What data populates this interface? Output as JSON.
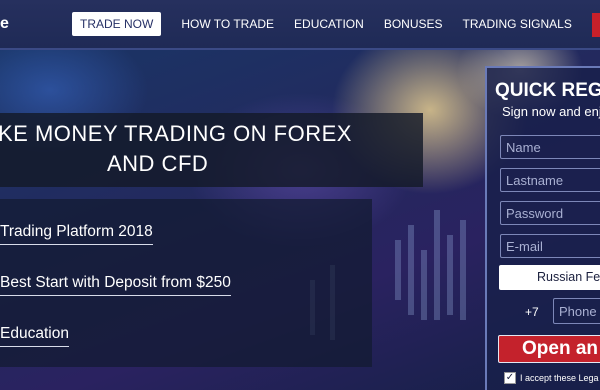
{
  "header": {
    "logo_fragment": "e",
    "nav": [
      {
        "label": "TRADE NOW",
        "active": true
      },
      {
        "label": "HOW TO TRADE",
        "active": false
      },
      {
        "label": "EDUCATION",
        "active": false
      },
      {
        "label": "BONUSES",
        "active": false
      },
      {
        "label": "TRADING SIGNALS",
        "active": false
      }
    ]
  },
  "hero": {
    "headline_line1": "KE MONEY TRADING ON FOREX",
    "headline_line2": "AND CFD",
    "features": [
      "Trading Platform 2018",
      "Best Start with Deposit from $250",
      "Education"
    ]
  },
  "registration": {
    "title": "QUICK REGI",
    "subtitle": "Sign now and enj",
    "name_placeholder": "Name",
    "lastname_placeholder": "Lastname",
    "password_placeholder": "Password",
    "email_placeholder": "E-mail",
    "country_value": "Russian Fe",
    "phone_prefix": "+7",
    "phone_placeholder": "Phone",
    "open_button": "Open an",
    "accept_text": "I accept these Lega",
    "checkbox_mark": "✓"
  },
  "colors": {
    "nav_bg": "#26305e",
    "accent_red": "#c4222c",
    "panel_bg": "#19204b"
  }
}
